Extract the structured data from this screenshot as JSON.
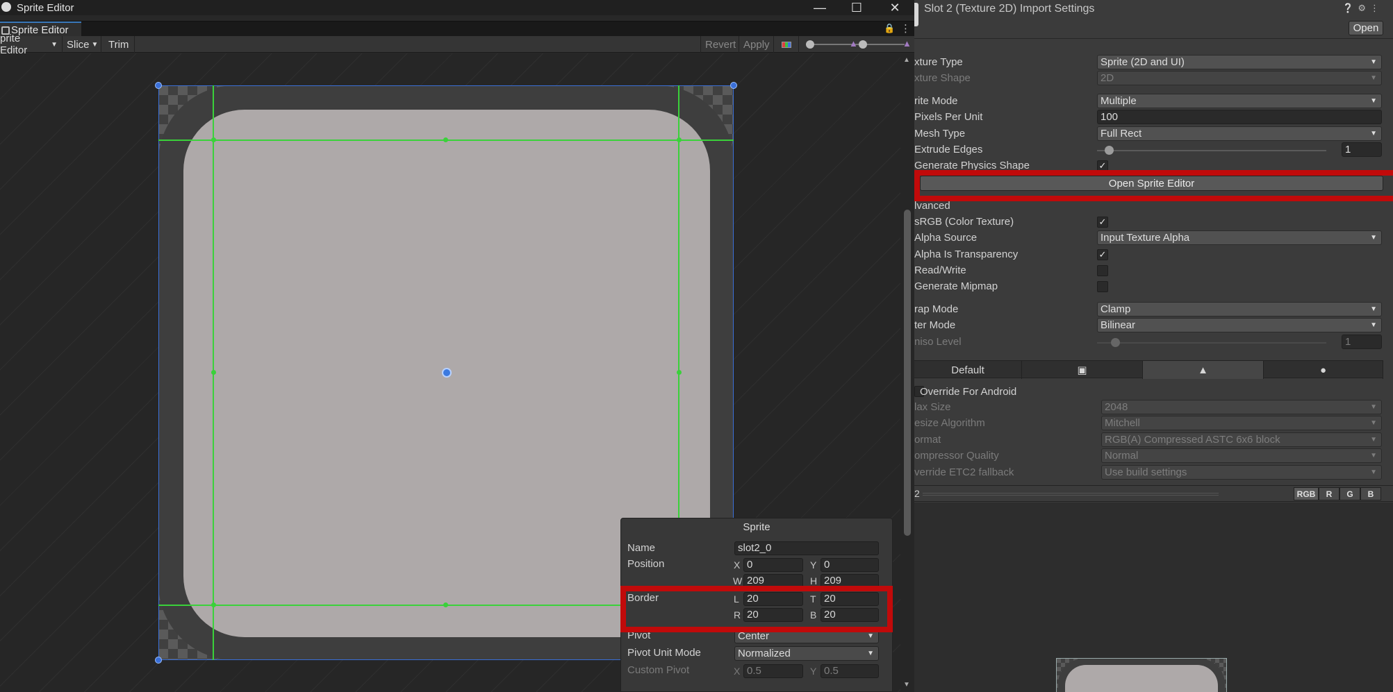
{
  "sprite_editor": {
    "window_title": "Sprite Editor",
    "tab_label": "Sprite Editor",
    "toolbar": {
      "mode_label": "prite Editor",
      "slice_label": "Slice",
      "trim_label": "Trim",
      "revert_label": "Revert",
      "apply_label": "Apply"
    },
    "sprite_panel": {
      "title": "Sprite",
      "name_label": "Name",
      "name_value": "slot2_0",
      "position_label": "Position",
      "x_label": "X",
      "x_value": "0",
      "y_label": "Y",
      "y_value": "0",
      "w_label": "W",
      "w_value": "209",
      "h_label": "H",
      "h_value": "209",
      "border_label": "Border",
      "l_label": "L",
      "l_value": "20",
      "t_label": "T",
      "t_value": "20",
      "r_label": "R",
      "r_value": "20",
      "b_label": "B",
      "b_value": "20",
      "pivot_label": "Pivot",
      "pivot_value": "Center",
      "pivot_unit_mode_label": "Pivot Unit Mode",
      "pivot_unit_mode_value": "Normalized",
      "custom_pivot_label": "Custom Pivot",
      "custom_x_label": "X",
      "custom_x_value": "0.5",
      "custom_y_label": "Y",
      "custom_y_value": "0.5"
    }
  },
  "inspector": {
    "title": "Slot 2 (Texture 2D) Import Settings",
    "open_label": "Open",
    "texture_type_label": "xture Type",
    "texture_type_value": "Sprite (2D and UI)",
    "texture_shape_label": "xture Shape",
    "texture_shape_value": "2D",
    "sprite_mode_label": "rite Mode",
    "sprite_mode_value": "Multiple",
    "pixels_per_unit_label": "Pixels Per Unit",
    "pixels_per_unit_value": "100",
    "mesh_type_label": "Mesh Type",
    "mesh_type_value": "Full Rect",
    "extrude_edges_label": "Extrude Edges",
    "extrude_edges_value": "1",
    "generate_physics_label": "Generate Physics Shape",
    "open_sprite_editor_label": "Open Sprite Editor",
    "advanced_label": "lvanced",
    "srgb_label": "sRGB (Color Texture)",
    "alpha_source_label": "Alpha Source",
    "alpha_source_value": "Input Texture Alpha",
    "alpha_transparency_label": "Alpha Is Transparency",
    "read_write_label": "Read/Write",
    "generate_mipmap_label": "Generate Mipmap",
    "wrap_mode_label": "rap Mode",
    "wrap_mode_value": "Clamp",
    "filter_mode_label": "ter Mode",
    "filter_mode_value": "Bilinear",
    "aniso_label": "niso Level",
    "aniso_value": "1",
    "platform_default_label": "Default",
    "override_label": "Override For Android",
    "max_size_label": "lax Size",
    "max_size_value": "2048",
    "resize_label": "esize Algorithm",
    "resize_value": "Mitchell",
    "format_label": "ormat",
    "format_value": "RGB(A) Compressed ASTC 6x6 block",
    "compressor_label": "ompressor Quality",
    "compressor_value": "Normal",
    "etc2_label": "verride ETC2 fallback",
    "etc2_value": "Use build settings",
    "preview_label": "2",
    "channels": [
      "RGB",
      "R",
      "G",
      "B"
    ]
  },
  "colors": {
    "highlight": "#c10a0a",
    "selection": "#3a6fd8",
    "slice_guides": "#3ad13a"
  }
}
